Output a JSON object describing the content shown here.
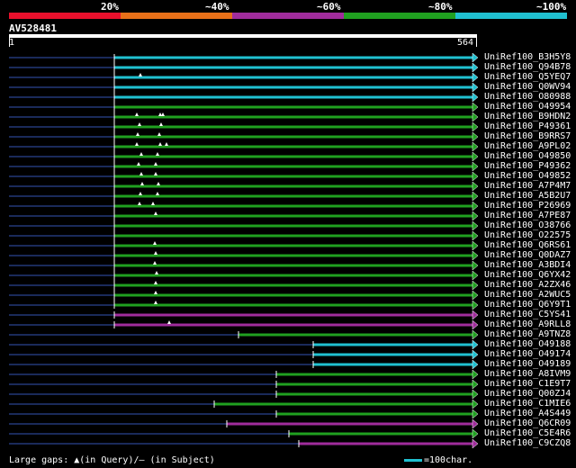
{
  "legend": [
    {
      "label": "20%",
      "color": "#e8102c"
    },
    {
      "label": "~40%",
      "color": "#e87018"
    },
    {
      "label": "~60%",
      "color": "#a02c9c"
    },
    {
      "label": "~80%",
      "color": "#20a020"
    },
    {
      "label": "~100%",
      "color": "#20c0d0"
    }
  ],
  "query": {
    "id": "AV528481",
    "start": "1",
    "end": "564"
  },
  "hits": [
    {
      "name": "UniRef100_B3H5Y8",
      "start": 127,
      "color": "#20c0d0",
      "gaps": []
    },
    {
      "name": "UniRef100_Q94B78",
      "start": 127,
      "color": "#20c0d0",
      "gaps": []
    },
    {
      "name": "UniRef100_Q5YEQ7",
      "start": 127,
      "color": "#20c0d0",
      "gaps": [
        156
      ]
    },
    {
      "name": "UniRef100_Q0WV94",
      "start": 127,
      "color": "#20c0d0",
      "gaps": []
    },
    {
      "name": "UniRef100_O80988",
      "start": 127,
      "color": "#20c0d0",
      "gaps": []
    },
    {
      "name": "UniRef100_O49954",
      "start": 127,
      "color": "#20a020",
      "gaps": []
    },
    {
      "name": "UniRef100_B9HDN2",
      "start": 127,
      "color": "#20a020",
      "gaps": [
        152,
        178,
        181
      ]
    },
    {
      "name": "UniRef100_P49361",
      "start": 127,
      "color": "#20a020",
      "gaps": [
        155,
        179
      ]
    },
    {
      "name": "UniRef100_B9RRS7",
      "start": 127,
      "color": "#20a020",
      "gaps": [
        153,
        177
      ]
    },
    {
      "name": "UniRef100_A9PL02",
      "start": 127,
      "color": "#20a020",
      "gaps": [
        152,
        178,
        185
      ]
    },
    {
      "name": "UniRef100_O49850",
      "start": 127,
      "color": "#20a020",
      "gaps": [
        157,
        175
      ]
    },
    {
      "name": "UniRef100_P49362",
      "start": 127,
      "color": "#20a020",
      "gaps": [
        154,
        173
      ]
    },
    {
      "name": "UniRef100_O49852",
      "start": 127,
      "color": "#20a020",
      "gaps": [
        157,
        173
      ]
    },
    {
      "name": "UniRef100_A7P4M7",
      "start": 127,
      "color": "#20a020",
      "gaps": [
        158,
        176
      ]
    },
    {
      "name": "UniRef100_A5B2U7",
      "start": 127,
      "color": "#20a020",
      "gaps": [
        156,
        175
      ]
    },
    {
      "name": "UniRef100_P26969",
      "start": 127,
      "color": "#20a020",
      "gaps": [
        155,
        170
      ]
    },
    {
      "name": "UniRef100_A7PE87",
      "start": 127,
      "color": "#20a020",
      "gaps": [
        173
      ]
    },
    {
      "name": "UniRef100_O38766",
      "start": 127,
      "color": "#20a020",
      "gaps": []
    },
    {
      "name": "UniRef100_O22575",
      "start": 127,
      "color": "#20a020",
      "gaps": []
    },
    {
      "name": "UniRef100_Q6RS61",
      "start": 127,
      "color": "#20a020",
      "gaps": [
        172
      ]
    },
    {
      "name": "UniRef100_Q0DAZ7",
      "start": 127,
      "color": "#20a020",
      "gaps": [
        173
      ]
    },
    {
      "name": "UniRef100_A3BDI4",
      "start": 127,
      "color": "#20a020",
      "gaps": [
        172
      ]
    },
    {
      "name": "UniRef100_Q6YX42",
      "start": 127,
      "color": "#20a020",
      "gaps": [
        174
      ]
    },
    {
      "name": "UniRef100_A2ZX46",
      "start": 127,
      "color": "#20a020",
      "gaps": [
        173
      ]
    },
    {
      "name": "UniRef100_A2WUC5",
      "start": 127,
      "color": "#20a020",
      "gaps": [
        173
      ]
    },
    {
      "name": "UniRef100_Q6Y9T1",
      "start": 127,
      "color": "#20a020",
      "gaps": [
        173
      ]
    },
    {
      "name": "UniRef100_C5YS41",
      "start": 127,
      "color": "#a02c9c",
      "gaps": []
    },
    {
      "name": "UniRef100_A9RLL8",
      "start": 127,
      "color": "#a02c9c",
      "gaps": [
        188
      ]
    },
    {
      "name": "UniRef100_A9TNZ8",
      "start": 265,
      "color": "#20a020",
      "gaps": []
    },
    {
      "name": "UniRef100_O49188",
      "start": 348,
      "color": "#20c0d0",
      "gaps": []
    },
    {
      "name": "UniRef100_O49174",
      "start": 348,
      "color": "#20c0d0",
      "gaps": []
    },
    {
      "name": "UniRef100_O49189",
      "start": 348,
      "color": "#20c0d0",
      "gaps": []
    },
    {
      "name": "UniRef100_A8IVM9",
      "start": 307,
      "color": "#20a020",
      "gaps": []
    },
    {
      "name": "UniRef100_C1E9T7",
      "start": 307,
      "color": "#20a020",
      "gaps": []
    },
    {
      "name": "UniRef100_Q00ZJ4",
      "start": 307,
      "color": "#20a020",
      "gaps": []
    },
    {
      "name": "UniRef100_C1MIE6",
      "start": 238,
      "color": "#20a020",
      "gaps": []
    },
    {
      "name": "UniRef100_A4S449",
      "start": 307,
      "color": "#20a020",
      "gaps": []
    },
    {
      "name": "UniRef100_Q6CR09",
      "start": 252,
      "color": "#a02c9c",
      "gaps": []
    },
    {
      "name": "UniRef100_C5E4R6",
      "start": 321,
      "color": "#20a020",
      "gaps": []
    },
    {
      "name": "UniRef100_C9CZQ8",
      "start": 332,
      "color": "#a02c9c",
      "gaps": []
    }
  ],
  "footer": {
    "text": "Large gaps: ▲(in Query)/— (in Subject)",
    "scale_label": "=100char."
  }
}
